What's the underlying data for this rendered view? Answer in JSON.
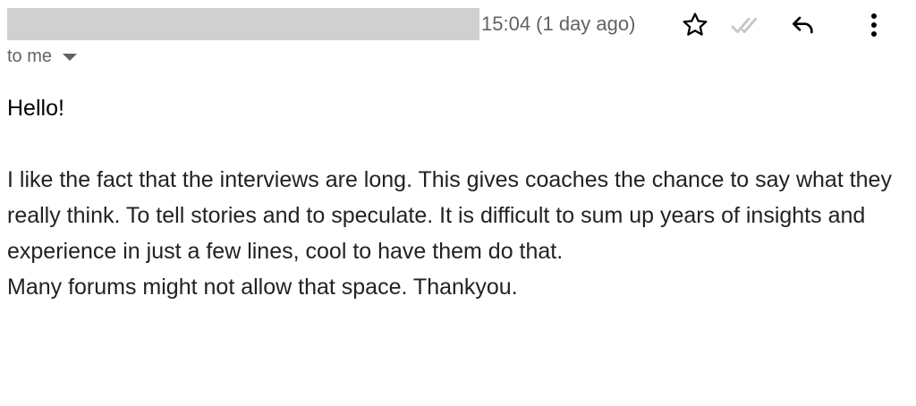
{
  "header": {
    "timestamp": "15:04 (1 day ago)",
    "recipient": "to me"
  },
  "icons": {
    "star": "star-icon",
    "read": "double-check-icon",
    "reply": "reply-icon",
    "more": "more-vertical-icon"
  },
  "colors": {
    "secondary_text": "#5f6368",
    "redaction": "#d0d0d0",
    "check_grey": "#c4c7c5"
  },
  "message": {
    "greeting": "Hello!",
    "paragraph_1": "I like the fact that the interviews are long. This gives coaches the chance to say what they really think. To tell stories and to speculate. It is difficult to sum up years of insights and experience in just a few lines, cool to have them do that.",
    "paragraph_2": "Many forums might not allow that space. Thankyou."
  }
}
